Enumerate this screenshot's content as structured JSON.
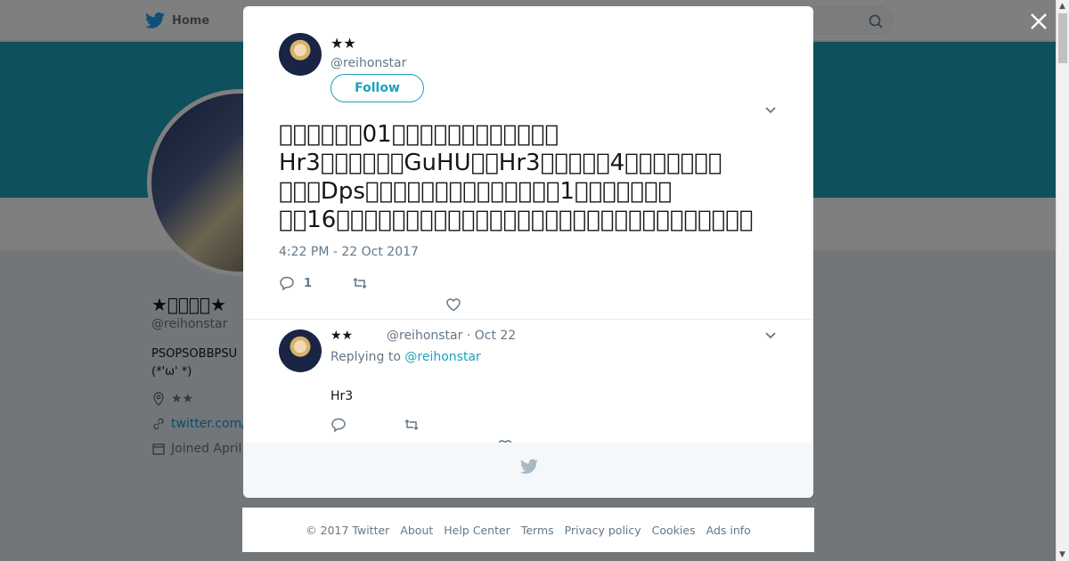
{
  "nav": {
    "home_label": "Home",
    "search_icon": "search-icon"
  },
  "profile": {
    "name": "★\u0000\u0000\u0000\u0000★",
    "handle": "@reihonstar",
    "bio_line1": "PSOPSOBBPSU",
    "bio_line2": "(*'ω' *)",
    "location": "★★",
    "website": "twitter.com/",
    "joined": "Joined April"
  },
  "modal": {
    "author_name": "★★",
    "author_handle": "@reihonstar",
    "follow_label": "Follow",
    "tweet_line1": "\u0000\u0000\u0000\u0000\u0000\u000001\u0000\u0000\u0000\u0000\u0000\u0000\u0000\u0000\u0000\u0000\u0000\u0000",
    "tweet_line2": "Hr3\u0000\u0000\u0000\u0000\u0000\u0000GuHU\u0000\u0000Hr3\u0000\u0000\u0000\u0000\u00004\u0000\u0000\u0000\u0000\u0000\u0000\u0000",
    "tweet_line3": "\u0000\u0000\u0000Dps\u0000\u0000\u0000\u0000\u0000\u0000\u0000\u0000\u0000\u0000\u0000\u0000\u0000\u00001\u0000\u0000\u0000\u0000\u0000\u0000\u0000",
    "tweet_line4": "\u0000\u000016\u0000\u0000\u0000\u0000\u0000\u0000\u0000\u0000\u0000\u0000\u0000\u0000\u0000\u0000\u0000\u0000\u0000\u0000\u0000\u0000\u0000\u0000\u0000\u0000\u0000\u0000\u0000\u0000\u0000\u0000",
    "timestamp": "4:22 PM - 22 Oct 2017",
    "reply_count": "1",
    "reply": {
      "name": "★★",
      "handle_date": "@reihonstar · Oct 22",
      "replying_prefix": "Replying to",
      "replying_to": "@reihonstar",
      "text": "Hr3"
    }
  },
  "footer": {
    "copyright": "© 2017 Twitter",
    "about": "About",
    "help": "Help Center",
    "terms": "Terms",
    "privacy": "Privacy policy",
    "cookies": "Cookies",
    "ads": "Ads info"
  },
  "colors": {
    "banner": "#1da1b8",
    "accent": "#1da1b8",
    "link": "#1b95e0"
  }
}
